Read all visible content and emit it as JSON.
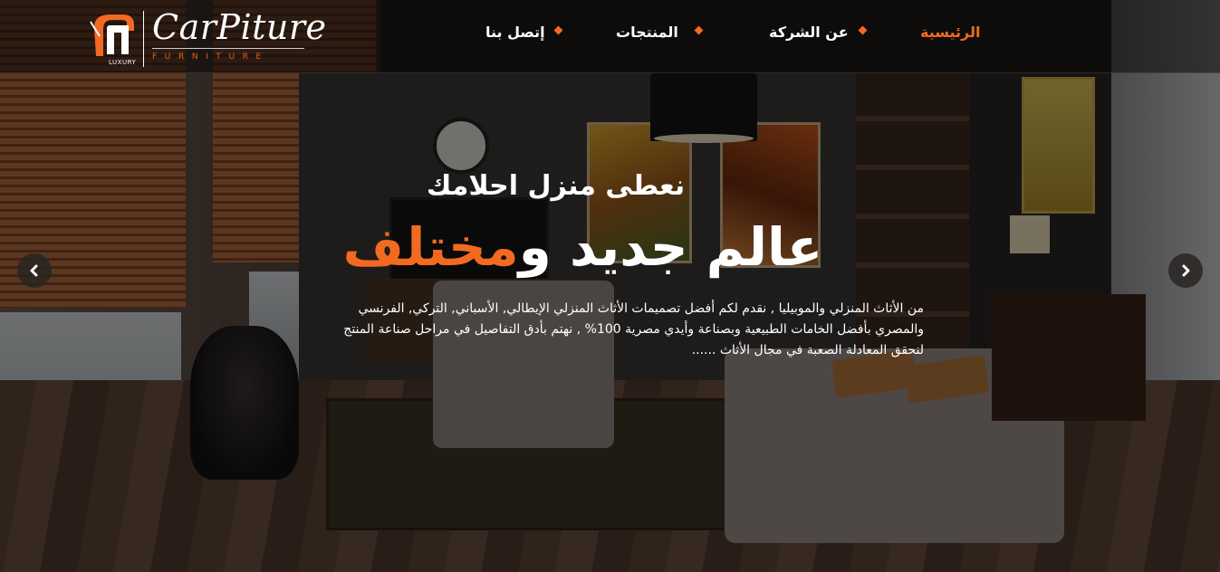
{
  "brand": {
    "name": "CarPiture",
    "subtitle": "FURNITURE",
    "tag": "LUXURY",
    "accent_color": "#f26a21"
  },
  "nav": {
    "items": [
      {
        "label": "الرئيسية",
        "active": true
      },
      {
        "label": "عن الشركة",
        "active": false
      },
      {
        "label": "المنتجات",
        "active": false
      },
      {
        "label": "إتصل بنا",
        "active": false
      }
    ]
  },
  "hero": {
    "subtitle": "نعطى منزل احلامك",
    "title_main": "عالم جديد و",
    "title_accent": "مختلف",
    "body": "من الأثاث المنزلي والموبيليا , نقدم لكم أفضل تصميمات الأثاث المنزلي الإيطالي, الأسباني, التركي, الفرنسي والمصري بأفضل الخامات الطبيعية وبصناعة وأيدي مصرية 100% , نهتم بأدق التفاصيل في مراحل صناعة المنتج لنحقق المعادلة الصعبة في مجال الأثاث ......"
  },
  "carousel": {
    "prev_icon": "chevron-left-icon",
    "next_icon": "chevron-right-icon"
  }
}
